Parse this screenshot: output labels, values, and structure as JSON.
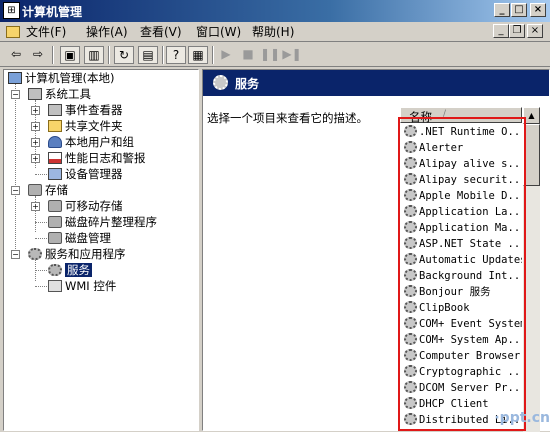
{
  "window": {
    "title": "计算机管理",
    "app_icon": "computer-management-icon"
  },
  "window_buttons": {
    "minimize": "_",
    "maximize": "□",
    "close": "×"
  },
  "menu": [
    "文件(F)",
    "操作(A)",
    "查看(V)",
    "窗口(W)",
    "帮助(H)"
  ],
  "mdi_buttons": {
    "minimize": "_",
    "restore": "❐",
    "close": "×"
  },
  "toolbar": [
    "back-icon",
    "forward-icon",
    "up-folder-icon",
    "show-hide-tree-icon",
    "refresh-icon",
    "export-list-icon",
    "help-icon",
    "properties-icon",
    "start-service-icon",
    "stop-service-icon",
    "pause-service-icon",
    "restart-service-icon"
  ],
  "tree": {
    "root": "计算机管理(本地)",
    "system_tools": "系统工具",
    "event_viewer": "事件查看器",
    "shared_folders": "共享文件夹",
    "local_users": "本地用户和组",
    "perf_logs": "性能日志和警报",
    "device_manager": "设备管理器",
    "storage": "存储",
    "removable_storage": "可移动存储",
    "defrag": "磁盘碎片整理程序",
    "disk_mgmt": "磁盘管理",
    "services_apps": "服务和应用程序",
    "services": "服务",
    "wmi": "WMI 控件"
  },
  "right_pane": {
    "header": "服务",
    "description": "选择一个项目来查看它的描述。",
    "column_name": "名称",
    "sort_arrow": "/"
  },
  "services": [
    ".NET Runtime O...",
    "Alerter",
    "Alipay alive s...",
    "Alipay securit...",
    "Apple Mobile D...",
    "Application La...",
    "Application Ma...",
    "ASP.NET State ...",
    "Automatic Updates",
    "Background Int...",
    "Bonjour 服务",
    "ClipBook",
    "COM+ Event System",
    "COM+ System Ap...",
    "Computer Browser",
    "Cryptographic ...",
    "DCOM Server Pr...",
    "DHCP Client",
    "Distributed Li..."
  ],
  "watermark": "·ppt.cn",
  "colors": {
    "title_bar": "#0a246a",
    "selection": "#0a246a",
    "highlight_box": "#e01818",
    "face": "#d4d0c8"
  }
}
